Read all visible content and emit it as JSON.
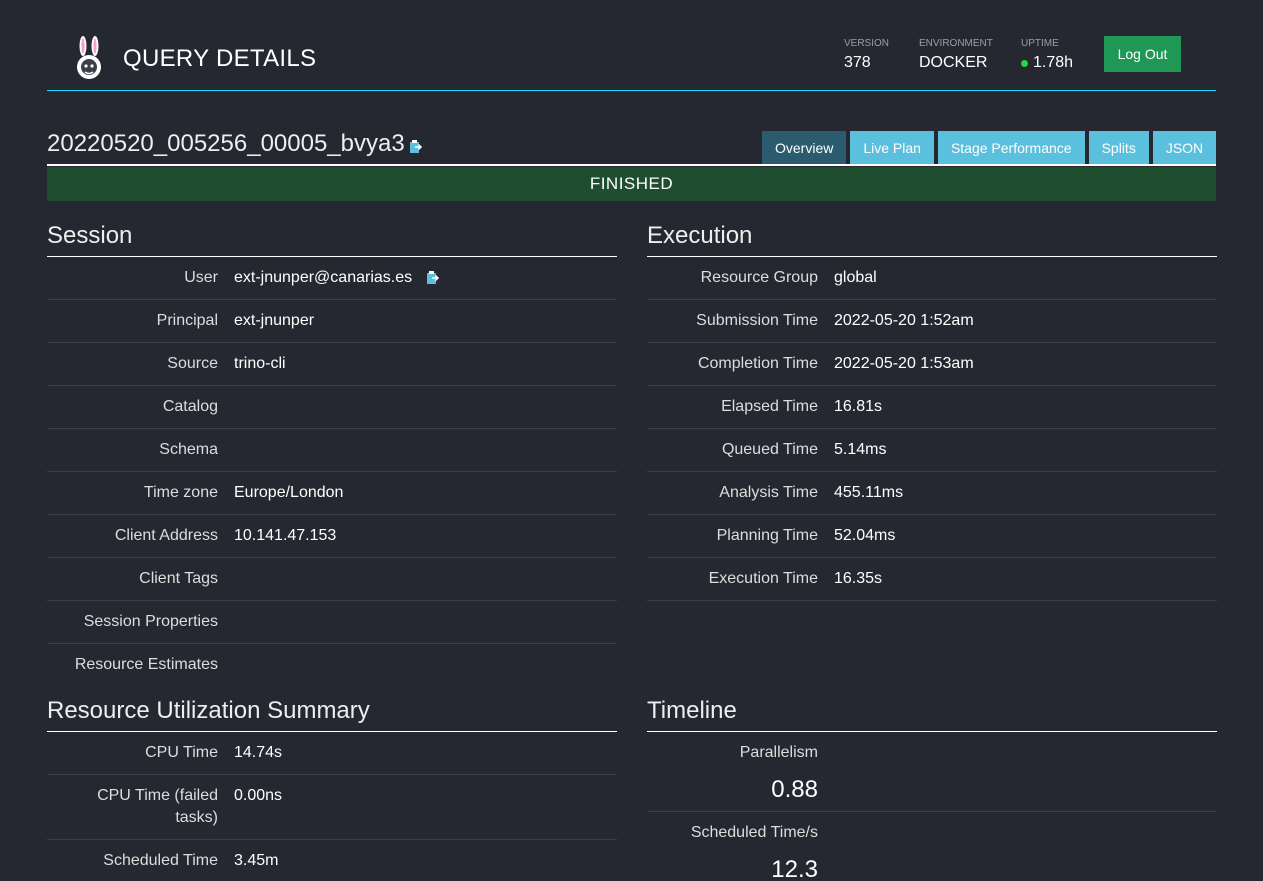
{
  "header": {
    "title": "QUERY DETAILS",
    "version_label": "VERSION",
    "version_value": "378",
    "environment_label": "ENVIRONMENT",
    "environment_value": "DOCKER",
    "uptime_label": "UPTIME",
    "uptime_value": "1.78h",
    "logout_label": "Log Out"
  },
  "query": {
    "id": "20220520_005256_00005_bvya3",
    "state": "FINISHED"
  },
  "tabs": [
    {
      "label": "Overview",
      "active": true
    },
    {
      "label": "Live Plan"
    },
    {
      "label": "Stage Performance"
    },
    {
      "label": "Splits"
    },
    {
      "label": "JSON"
    }
  ],
  "session": {
    "title": "Session",
    "rows": [
      {
        "key": "User",
        "value": "ext-jnunper@canarias.es"
      },
      {
        "key": "Principal",
        "value": "ext-jnunper"
      },
      {
        "key": "Source",
        "value": "trino-cli"
      },
      {
        "key": "Catalog",
        "value": ""
      },
      {
        "key": "Schema",
        "value": ""
      },
      {
        "key": "Time zone",
        "value": "Europe/London"
      },
      {
        "key": "Client Address",
        "value": "10.141.47.153"
      },
      {
        "key": "Client Tags",
        "value": ""
      },
      {
        "key": "Session Properties",
        "value": ""
      },
      {
        "key": "Resource Estimates",
        "value": ""
      }
    ]
  },
  "execution": {
    "title": "Execution",
    "rows": [
      {
        "key": "Resource Group",
        "value": "global"
      },
      {
        "key": "Submission Time",
        "value": "2022-05-20 1:52am"
      },
      {
        "key": "Completion Time",
        "value": "2022-05-20 1:53am"
      },
      {
        "key": "Elapsed Time",
        "value": "16.81s"
      },
      {
        "key": "Queued Time",
        "value": "5.14ms"
      },
      {
        "key": "Analysis Time",
        "value": "455.11ms"
      },
      {
        "key": "Planning Time",
        "value": "52.04ms"
      },
      {
        "key": "Execution Time",
        "value": "16.35s"
      }
    ]
  },
  "resource_utilization": {
    "title": "Resource Utilization Summary",
    "rows": [
      {
        "key": "CPU Time",
        "value": "14.74s"
      },
      {
        "key": "CPU Time (failed tasks)",
        "value": "0.00ns"
      },
      {
        "key": "Scheduled Time",
        "value": "3.45m"
      }
    ]
  },
  "timeline": {
    "title": "Timeline",
    "rows": [
      {
        "key": "Parallelism",
        "value": "0.88"
      },
      {
        "key": "Scheduled Time/s",
        "value": "12.3"
      }
    ]
  },
  "colors": {
    "background": "#252830",
    "accent_line": "#1edcff",
    "tab": "#5bc0de",
    "tab_active": "#2b5b6e",
    "status_finished": "#1e4d30",
    "logout": "#1f9755"
  }
}
